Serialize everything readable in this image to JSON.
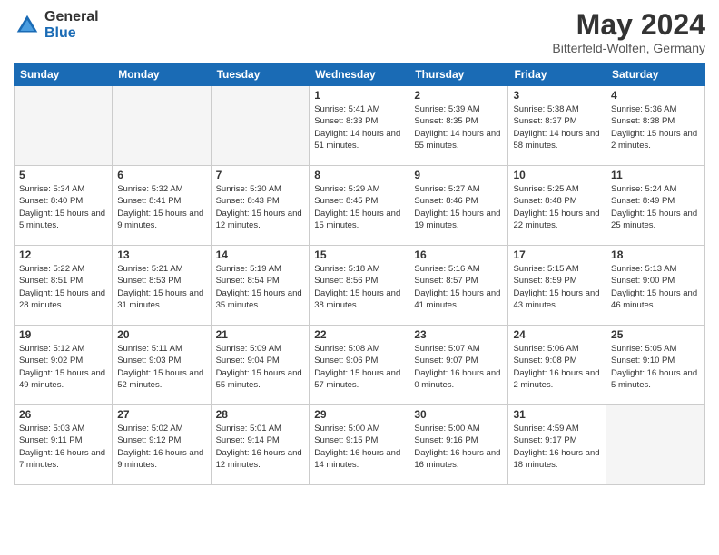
{
  "header": {
    "logo_general": "General",
    "logo_blue": "Blue",
    "title": "May 2024",
    "location": "Bitterfeld-Wolfen, Germany"
  },
  "weekdays": [
    "Sunday",
    "Monday",
    "Tuesday",
    "Wednesday",
    "Thursday",
    "Friday",
    "Saturday"
  ],
  "weeks": [
    [
      {
        "day": "",
        "empty": true
      },
      {
        "day": "",
        "empty": true
      },
      {
        "day": "",
        "empty": true
      },
      {
        "day": "1",
        "sunrise": "Sunrise: 5:41 AM",
        "sunset": "Sunset: 8:33 PM",
        "daylight": "Daylight: 14 hours and 51 minutes."
      },
      {
        "day": "2",
        "sunrise": "Sunrise: 5:39 AM",
        "sunset": "Sunset: 8:35 PM",
        "daylight": "Daylight: 14 hours and 55 minutes."
      },
      {
        "day": "3",
        "sunrise": "Sunrise: 5:38 AM",
        "sunset": "Sunset: 8:37 PM",
        "daylight": "Daylight: 14 hours and 58 minutes."
      },
      {
        "day": "4",
        "sunrise": "Sunrise: 5:36 AM",
        "sunset": "Sunset: 8:38 PM",
        "daylight": "Daylight: 15 hours and 2 minutes."
      }
    ],
    [
      {
        "day": "5",
        "sunrise": "Sunrise: 5:34 AM",
        "sunset": "Sunset: 8:40 PM",
        "daylight": "Daylight: 15 hours and 5 minutes."
      },
      {
        "day": "6",
        "sunrise": "Sunrise: 5:32 AM",
        "sunset": "Sunset: 8:41 PM",
        "daylight": "Daylight: 15 hours and 9 minutes."
      },
      {
        "day": "7",
        "sunrise": "Sunrise: 5:30 AM",
        "sunset": "Sunset: 8:43 PM",
        "daylight": "Daylight: 15 hours and 12 minutes."
      },
      {
        "day": "8",
        "sunrise": "Sunrise: 5:29 AM",
        "sunset": "Sunset: 8:45 PM",
        "daylight": "Daylight: 15 hours and 15 minutes."
      },
      {
        "day": "9",
        "sunrise": "Sunrise: 5:27 AM",
        "sunset": "Sunset: 8:46 PM",
        "daylight": "Daylight: 15 hours and 19 minutes."
      },
      {
        "day": "10",
        "sunrise": "Sunrise: 5:25 AM",
        "sunset": "Sunset: 8:48 PM",
        "daylight": "Daylight: 15 hours and 22 minutes."
      },
      {
        "day": "11",
        "sunrise": "Sunrise: 5:24 AM",
        "sunset": "Sunset: 8:49 PM",
        "daylight": "Daylight: 15 hours and 25 minutes."
      }
    ],
    [
      {
        "day": "12",
        "sunrise": "Sunrise: 5:22 AM",
        "sunset": "Sunset: 8:51 PM",
        "daylight": "Daylight: 15 hours and 28 minutes."
      },
      {
        "day": "13",
        "sunrise": "Sunrise: 5:21 AM",
        "sunset": "Sunset: 8:53 PM",
        "daylight": "Daylight: 15 hours and 31 minutes."
      },
      {
        "day": "14",
        "sunrise": "Sunrise: 5:19 AM",
        "sunset": "Sunset: 8:54 PM",
        "daylight": "Daylight: 15 hours and 35 minutes."
      },
      {
        "day": "15",
        "sunrise": "Sunrise: 5:18 AM",
        "sunset": "Sunset: 8:56 PM",
        "daylight": "Daylight: 15 hours and 38 minutes."
      },
      {
        "day": "16",
        "sunrise": "Sunrise: 5:16 AM",
        "sunset": "Sunset: 8:57 PM",
        "daylight": "Daylight: 15 hours and 41 minutes."
      },
      {
        "day": "17",
        "sunrise": "Sunrise: 5:15 AM",
        "sunset": "Sunset: 8:59 PM",
        "daylight": "Daylight: 15 hours and 43 minutes."
      },
      {
        "day": "18",
        "sunrise": "Sunrise: 5:13 AM",
        "sunset": "Sunset: 9:00 PM",
        "daylight": "Daylight: 15 hours and 46 minutes."
      }
    ],
    [
      {
        "day": "19",
        "sunrise": "Sunrise: 5:12 AM",
        "sunset": "Sunset: 9:02 PM",
        "daylight": "Daylight: 15 hours and 49 minutes."
      },
      {
        "day": "20",
        "sunrise": "Sunrise: 5:11 AM",
        "sunset": "Sunset: 9:03 PM",
        "daylight": "Daylight: 15 hours and 52 minutes."
      },
      {
        "day": "21",
        "sunrise": "Sunrise: 5:09 AM",
        "sunset": "Sunset: 9:04 PM",
        "daylight": "Daylight: 15 hours and 55 minutes."
      },
      {
        "day": "22",
        "sunrise": "Sunrise: 5:08 AM",
        "sunset": "Sunset: 9:06 PM",
        "daylight": "Daylight: 15 hours and 57 minutes."
      },
      {
        "day": "23",
        "sunrise": "Sunrise: 5:07 AM",
        "sunset": "Sunset: 9:07 PM",
        "daylight": "Daylight: 16 hours and 0 minutes."
      },
      {
        "day": "24",
        "sunrise": "Sunrise: 5:06 AM",
        "sunset": "Sunset: 9:08 PM",
        "daylight": "Daylight: 16 hours and 2 minutes."
      },
      {
        "day": "25",
        "sunrise": "Sunrise: 5:05 AM",
        "sunset": "Sunset: 9:10 PM",
        "daylight": "Daylight: 16 hours and 5 minutes."
      }
    ],
    [
      {
        "day": "26",
        "sunrise": "Sunrise: 5:03 AM",
        "sunset": "Sunset: 9:11 PM",
        "daylight": "Daylight: 16 hours and 7 minutes."
      },
      {
        "day": "27",
        "sunrise": "Sunrise: 5:02 AM",
        "sunset": "Sunset: 9:12 PM",
        "daylight": "Daylight: 16 hours and 9 minutes."
      },
      {
        "day": "28",
        "sunrise": "Sunrise: 5:01 AM",
        "sunset": "Sunset: 9:14 PM",
        "daylight": "Daylight: 16 hours and 12 minutes."
      },
      {
        "day": "29",
        "sunrise": "Sunrise: 5:00 AM",
        "sunset": "Sunset: 9:15 PM",
        "daylight": "Daylight: 16 hours and 14 minutes."
      },
      {
        "day": "30",
        "sunrise": "Sunrise: 5:00 AM",
        "sunset": "Sunset: 9:16 PM",
        "daylight": "Daylight: 16 hours and 16 minutes."
      },
      {
        "day": "31",
        "sunrise": "Sunrise: 4:59 AM",
        "sunset": "Sunset: 9:17 PM",
        "daylight": "Daylight: 16 hours and 18 minutes."
      },
      {
        "day": "",
        "empty": true
      }
    ]
  ]
}
